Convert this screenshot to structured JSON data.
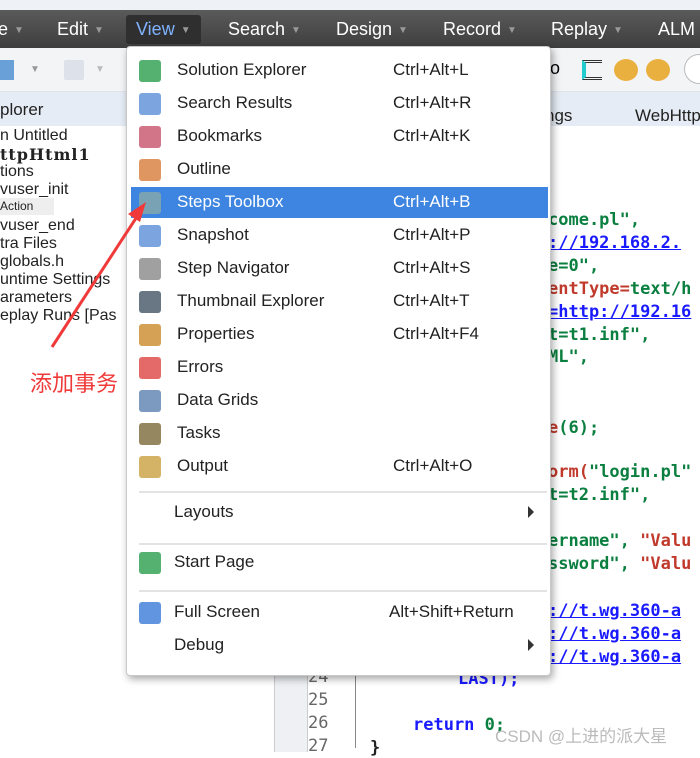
{
  "menubar": {
    "items": [
      {
        "label": "e"
      },
      {
        "label": "Edit"
      },
      {
        "label": "View"
      },
      {
        "label": "Search"
      },
      {
        "label": "Design"
      },
      {
        "label": "Record"
      },
      {
        "label": "Replay"
      },
      {
        "label": "ALM"
      }
    ]
  },
  "panel": {
    "title": "plorer"
  },
  "tabs": [
    {
      "label": "ngs"
    },
    {
      "label": "WebHttp"
    }
  ],
  "toolbar": {
    "partial_label": "o"
  },
  "tree": [
    "n Untitled",
    "ttpHtml1",
    "tions",
    "vuser_init",
    "Action",
    "vuser_end",
    "tra Files",
    "globals.h",
    "untime Settings",
    "arameters",
    "eplay Runs [Pas"
  ],
  "view_menu": {
    "items": [
      {
        "label": "Solution Explorer",
        "shortcut": "Ctrl+Alt+L",
        "icon": "solution-explorer-icon"
      },
      {
        "label": "Search Results",
        "shortcut": "Ctrl+Alt+R",
        "icon": "search-results-icon"
      },
      {
        "label": "Bookmarks",
        "shortcut": "Ctrl+Alt+K",
        "icon": "bookmarks-icon"
      },
      {
        "label": "Outline",
        "shortcut": "",
        "icon": "outline-icon"
      },
      {
        "label": "Steps Toolbox",
        "shortcut": "Ctrl+Alt+B",
        "icon": "steps-toolbox-icon",
        "selected": true
      },
      {
        "label": "Snapshot",
        "shortcut": "Ctrl+Alt+P",
        "icon": "snapshot-icon"
      },
      {
        "label": "Step Navigator",
        "shortcut": "Ctrl+Alt+S",
        "icon": "step-navigator-icon"
      },
      {
        "label": "Thumbnail Explorer",
        "shortcut": "Ctrl+Alt+T",
        "icon": "thumbnail-explorer-icon"
      },
      {
        "label": "Properties",
        "shortcut": "Ctrl+Alt+F4",
        "icon": "properties-icon"
      },
      {
        "label": "Errors",
        "shortcut": "",
        "icon": "errors-icon"
      },
      {
        "label": "Data Grids",
        "shortcut": "",
        "icon": "data-grids-icon"
      },
      {
        "label": "Tasks",
        "shortcut": "",
        "icon": "tasks-icon"
      },
      {
        "label": "Output",
        "shortcut": "Ctrl+Alt+O",
        "icon": "output-icon"
      },
      {
        "label": "Layouts",
        "shortcut": "",
        "submenu": true
      },
      {
        "label": "Start Page",
        "shortcut": "",
        "icon": "start-page-icon"
      },
      {
        "label": "Full Screen",
        "shortcut": "Alt+Shift+Return",
        "icon": "full-screen-icon"
      },
      {
        "label": "Debug",
        "shortcut": "",
        "submenu": true
      }
    ]
  },
  "code": [
    [
      "str",
      "come.pl\","
    ],
    [
      "url",
      "://192.168.2."
    ],
    [
      "str",
      "e=0\","
    ],
    [
      "fn",
      "entType=",
      "str",
      "text/h"
    ],
    [
      "url",
      "=http://192.16"
    ],
    [
      "str",
      "t=t1.inf\","
    ],
    [
      "str",
      "ML\","
    ],
    [
      "fn",
      "e",
      "nm",
      "(6);"
    ],
    [
      "fn",
      "orm(",
      "str",
      "\"login.pl\""
    ],
    [
      "str",
      "t=t2.inf\","
    ],
    [
      "str",
      "ername\", ",
      "fn",
      "\"Valu"
    ],
    [
      "str",
      "ssword\", ",
      "fn",
      "\"Valu"
    ],
    [
      "url",
      "://t.wg.360-a"
    ],
    [
      "url",
      "://t.wg.360-a"
    ],
    [
      "url",
      "://t.wg.360-a"
    ]
  ],
  "line_numbers": [
    "24",
    "25",
    "26",
    "27"
  ],
  "code_tail": {
    "last": "LAST);",
    "ret_kw": "return",
    "ret_val": "0;",
    "brace": "}"
  },
  "annotation": "添加事务",
  "watermark": "CSDN @上进的派大星",
  "colors": {
    "menubar": "#4a4a4a",
    "selection": "#3d85e0",
    "annotation": "#f03a3a"
  }
}
